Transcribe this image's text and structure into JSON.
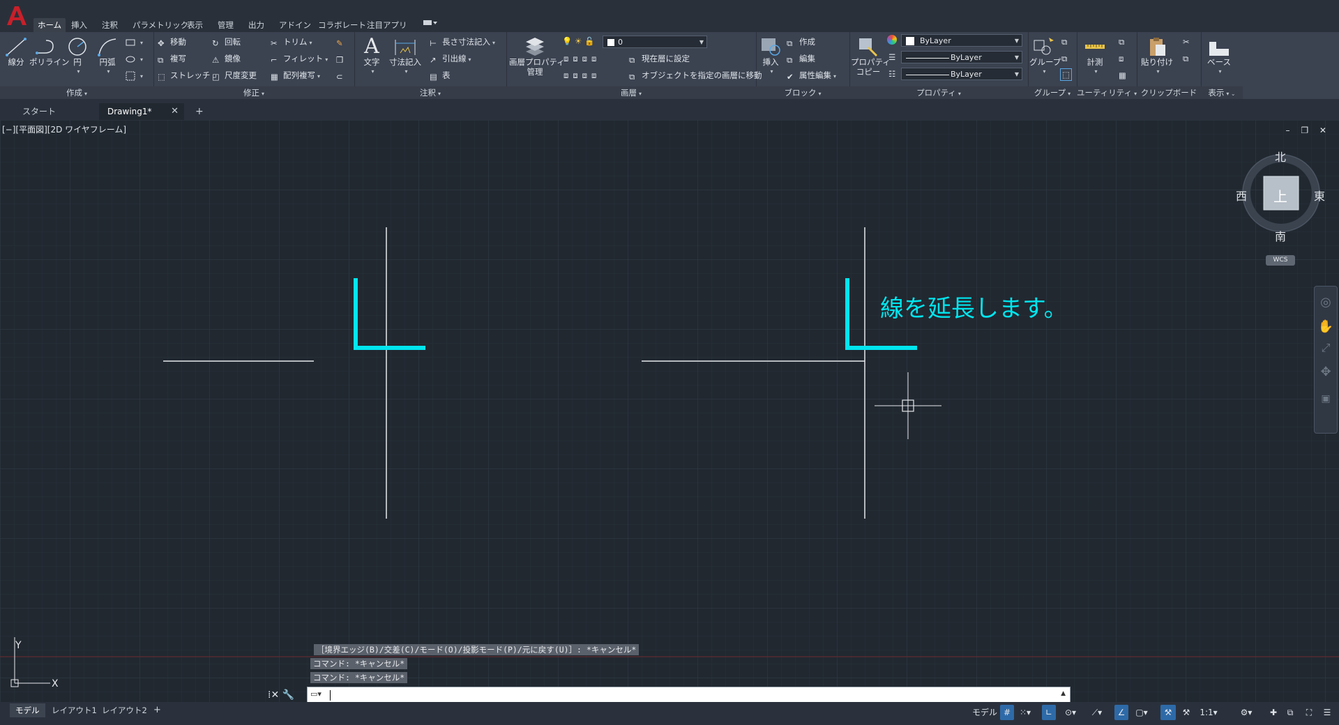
{
  "app": {
    "logo_letter": "A"
  },
  "menu": {
    "tabs": [
      "ホーム",
      "挿入",
      "注釈",
      "パラメトリック",
      "表示",
      "管理",
      "出力",
      "アドイン",
      "コラボレート",
      "注目アプリ"
    ]
  },
  "ribbon": {
    "draw": {
      "title": "作成",
      "line": "線分",
      "polyline": "ポリライン",
      "circle": "円",
      "arc": "円弧"
    },
    "modify": {
      "title": "修正",
      "move": "移動",
      "copy": "複写",
      "stretch": "ストレッチ",
      "rotate": "回転",
      "mirror": "鏡像",
      "scale": "尺度変更",
      "trim": "トリム",
      "fillet": "フィレット",
      "array": "配列複写"
    },
    "annotation": {
      "title": "注釈",
      "text": "文字",
      "dimension": "寸法記入",
      "linear": "長さ寸法記入",
      "leader": "引出線",
      "table": "表"
    },
    "layers": {
      "title": "画層",
      "properties_line1": "画層プロパティ",
      "properties_line2": "管理",
      "current_layer": "0",
      "set_current": "現在層に設定",
      "match_layer": "オブジェクトを指定の画層に移動"
    },
    "block": {
      "title": "ブロック",
      "insert": "挿入",
      "create": "作成",
      "edit": "編集",
      "attr_edit": "属性編集"
    },
    "properties": {
      "title": "プロパティ",
      "match_line1": "プロパティ",
      "match_line2": "コピー",
      "color": "ByLayer",
      "lineweight": "ByLayer",
      "linetype": "ByLayer"
    },
    "groups": {
      "title": "グループ",
      "group": "グループ"
    },
    "utilities": {
      "title": "ユーティリティ",
      "measure": "計測"
    },
    "clipboard": {
      "title": "クリップボード",
      "paste": "貼り付け"
    },
    "view": {
      "title": "表示",
      "base": "ベース"
    }
  },
  "doc_tabs": {
    "start": "スタート",
    "drawing": "Drawing1*",
    "close": "✕",
    "add": "+"
  },
  "viewport": {
    "label": "[−][平面図][2D ワイヤフレーム]",
    "controls": "– ❐ ✕",
    "annotation_text": "線を延長します。",
    "annotation_color": "#00e5ee"
  },
  "viewcube": {
    "north": "北",
    "south": "南",
    "east": "東",
    "west": "西",
    "top": "上",
    "wcs": "WCS"
  },
  "ucs": {
    "x": "X",
    "y": "Y"
  },
  "command": {
    "history": [
      "［境界エッジ(B)/交差(C)/モード(O)/投影モード(P)/元に戻す(U)］: *キャンセル*",
      "コマンド: *キャンセル*",
      "コマンド: *キャンセル*"
    ],
    "tools": "⁞✕ 🔧"
  },
  "status": {
    "layout_tabs": [
      "モデル",
      "レイアウト1",
      "レイアウト2"
    ],
    "add": "+",
    "model": "モデル",
    "scale": "1:1"
  }
}
